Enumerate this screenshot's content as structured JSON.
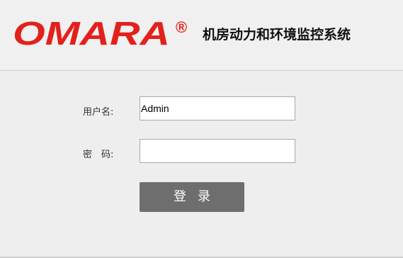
{
  "header": {
    "logo_text": "OMARA",
    "registered_mark": "®",
    "system_title": "机房动力和环境监控系统"
  },
  "login_form": {
    "username_label": "用户名:",
    "username_value": "Admin",
    "password_label": "密　码:",
    "password_value": "",
    "login_button_label": "登录"
  },
  "colors": {
    "brand_red": "#e2211c",
    "button_gray": "#6e6e6e",
    "background": "#eeeeee"
  }
}
